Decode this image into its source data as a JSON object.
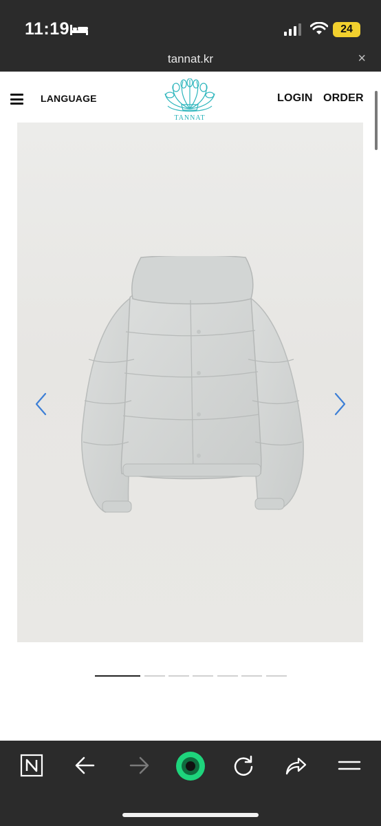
{
  "status_bar": {
    "time": "11:19",
    "battery_level": "24",
    "battery_color": "#f2d02e"
  },
  "browser": {
    "url": "tannat.kr",
    "close_glyph": "×"
  },
  "header": {
    "language_label": "LANGUAGE",
    "logo_text": "TANNAT",
    "login_label": "LOGIN",
    "order_label": "ORDER"
  },
  "carousel": {
    "image_subject": "light grey hooded puffer jacket",
    "total_slides": 7,
    "active_slide": 1,
    "arrow_color": "#3d7fd6"
  },
  "toolbar": {
    "icons": [
      "n-app-icon",
      "back-arrow-icon",
      "forward-arrow-icon",
      "green-circle-icon",
      "reload-icon",
      "share-icon",
      "menu-icon"
    ],
    "accent": "#1ed47c"
  }
}
